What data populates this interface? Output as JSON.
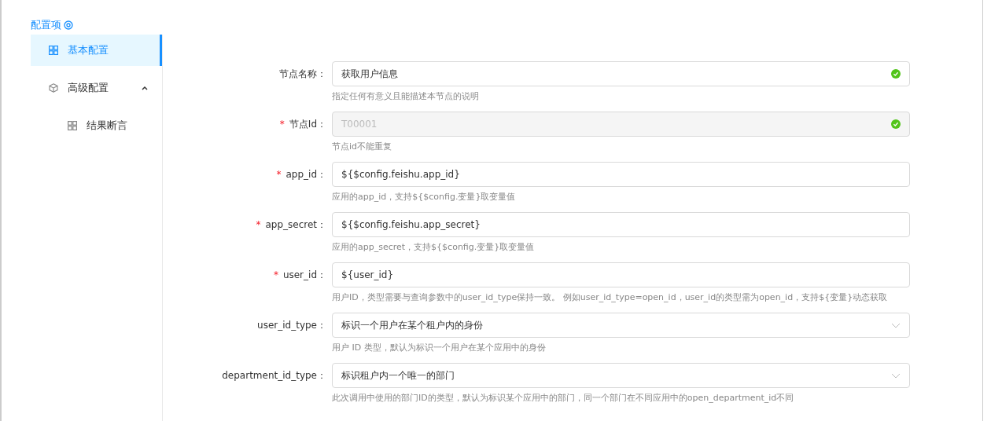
{
  "sidebar": {
    "title": "配置项",
    "items": [
      {
        "kind": "page",
        "label": "基本配置",
        "selected": true
      },
      {
        "kind": "group",
        "label": "高级配置",
        "selected": false,
        "expanded": true,
        "children": [
          {
            "kind": "page",
            "label": "结果断言",
            "selected": false
          }
        ]
      }
    ]
  },
  "form": {
    "fields": [
      {
        "kind": "text",
        "label": "节点名称：",
        "value": "获取用户信息",
        "disabled": false,
        "valid": true,
        "help": "指定任何有意义且能描述本节点的说明"
      },
      {
        "kind": "text",
        "required_mark": "*",
        "label": "节点Id：",
        "value": "T00001",
        "disabled": true,
        "valid": true,
        "help": "节点id不能重复"
      },
      {
        "kind": "text",
        "required_mark": "*",
        "label": "app_id：",
        "value": "${$config.feishu.app_id}",
        "disabled": false,
        "valid": false,
        "help": "应用的app_id，支持${$config.变量}取变量值"
      },
      {
        "kind": "text",
        "required_mark": "*",
        "label": "app_secret：",
        "value": "${$config.feishu.app_secret}",
        "disabled": false,
        "valid": false,
        "help": "应用的app_secret，支持${$config.变量}取变量值"
      },
      {
        "kind": "text",
        "required_mark": "*",
        "label": "user_id：",
        "value": "${user_id}",
        "disabled": false,
        "valid": false,
        "help": "用户ID，类型需要与查询参数中的user_id_type保持一致。 例如user_id_type=open_id，user_id的类型需为open_id，支持${变量}动态获取"
      },
      {
        "kind": "select",
        "label": "user_id_type：",
        "value": "标识一个用户在某个租户内的身份",
        "help": "用户 ID 类型，默认为标识一个用户在某个应用中的身份"
      },
      {
        "kind": "select",
        "label": "department_id_type：",
        "value": "标识租户内一个唯一的部门",
        "help": "此次调用中使用的部门ID的类型，默认为标识某个应用中的部门，同一个部门在不同应用中的open_department_id不同"
      }
    ]
  }
}
